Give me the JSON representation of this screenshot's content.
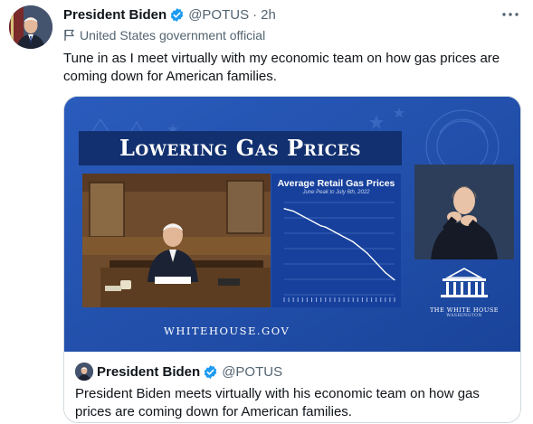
{
  "tweet": {
    "author_name": "President Biden",
    "handle": "@POTUS",
    "separator": "·",
    "time": "2h",
    "label": "United States government official",
    "text": "Tune in as I meet virtually with my economic team on how gas prices are coming down for American families.",
    "more_icon": "more-dots-icon"
  },
  "media": {
    "title": "Lowering Gas Prices",
    "chart_title": "Average Retail Gas Prices",
    "chart_subtitle": "June Peak to July 6th, 2022",
    "url_text": "WHITEHOUSE.GOV",
    "logo_text": "THE WHITE HOUSE",
    "logo_subtext": "WASHINGTON",
    "colors": {
      "background": "#1f4fa8",
      "panel": "#12306f"
    }
  },
  "chart_data": {
    "type": "line",
    "title": "Average Retail Gas Prices",
    "subtitle": "June Peak to July 6th, 2022",
    "trend": "declining",
    "values": [
      5.0,
      4.99,
      4.98,
      4.96,
      4.94,
      4.92,
      4.9,
      4.88,
      4.86,
      4.85,
      4.83,
      4.81,
      4.79,
      4.77,
      4.75,
      4.73,
      4.7,
      4.67,
      4.64,
      4.6,
      4.56,
      4.52,
      4.48,
      4.45,
      4.42
    ],
    "ylim": [
      4.3,
      5.05
    ],
    "line_color": "#ffffff"
  },
  "quote": {
    "author_name": "President Biden",
    "handle": "@POTUS",
    "text": "President Biden meets virtually with his economic team on how gas prices are coming down for American families."
  },
  "colors": {
    "verified": "#1d9bf0",
    "secondary_text": "#536471",
    "border": "#cfd9de"
  }
}
